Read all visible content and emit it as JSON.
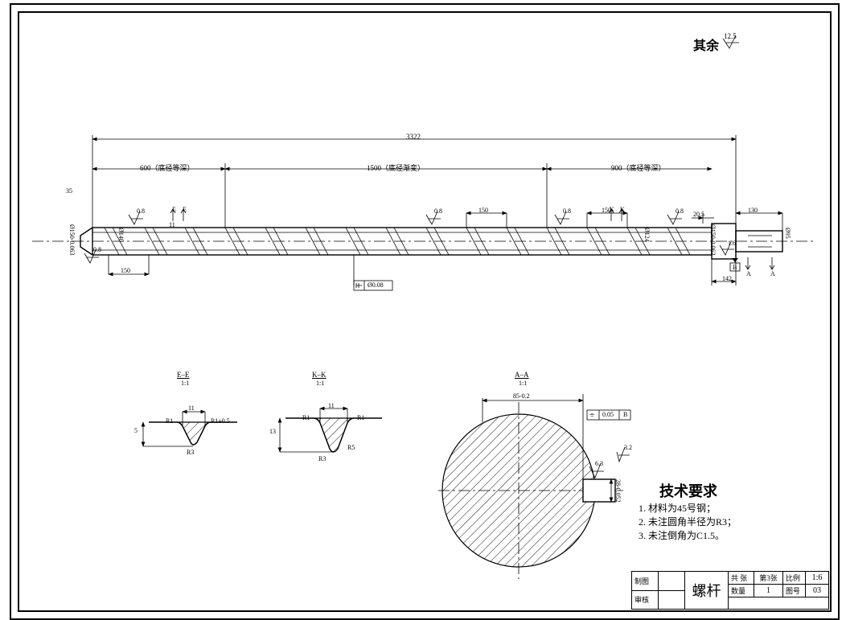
{
  "header": {
    "surface_note": "其余",
    "surface_ra": "12.5"
  },
  "main_view": {
    "overall_length": "3322",
    "section_lengths": {
      "left": "600（底径等深）",
      "mid": "1500（底径渐变）",
      "right": "900（底径等深）"
    },
    "pitches": {
      "p1": "150",
      "p2": "150",
      "p3": "150"
    },
    "thread_width": "11",
    "thread_depth_left": "5",
    "left_small_dim": "35",
    "ra_labels": {
      "a": "0.8",
      "b": "0.8",
      "c": "0.8",
      "d": "0.8",
      "e": "0.8",
      "f": "1.6"
    },
    "diameters": {
      "d_left_outer": "Ø150-0.063",
      "d_core_left": "Ø140",
      "d_core_right": "Ø124",
      "d_right_outer": "Ø150-0.063",
      "d_shaft_end": "Ø95"
    },
    "end_dims": {
      "a": "20.5",
      "b": "130",
      "c": "142"
    },
    "section_marks": {
      "e": "E",
      "k": "K",
      "a": "A"
    },
    "datum_right": "B",
    "geo_tol": "Ø0.08"
  },
  "detail_E": {
    "title": "E–E",
    "scale": "1:1",
    "w": "11",
    "h": "5",
    "r1": "R1",
    "r2": "R1±0.5",
    "r3": "R3"
  },
  "detail_K": {
    "title": "K–K",
    "scale": "1:1",
    "w": "11",
    "h": "13",
    "r_top_l": "R1",
    "r_top_r": "R1",
    "r_bot_l": "R3",
    "r_bot_r": "R5"
  },
  "detail_A": {
    "title": "A–A",
    "scale": "1:1",
    "key_w": "85-0.2",
    "key_h": "28-0.052",
    "ra": "6.3",
    "ra2": "3.2",
    "tol_frame": "0.05",
    "tol_datum": "B",
    "tol_sym": "⌯"
  },
  "notes": {
    "title": "技术要求",
    "items": [
      "1. 材料为45号钢；",
      "2. 未注圆角半径为R3；",
      "3. 未注倒角为C1.5。"
    ]
  },
  "title_block": {
    "part_name": "螺杆",
    "labels": {
      "sheets": "共 张",
      "sheet": "第3张",
      "scale_l": "比例",
      "scale_v": "1:6",
      "qty_l": "数量",
      "qty_v": "1",
      "dwg_l": "图号",
      "dwg_v": "03",
      "drawn": "制图",
      "check": "审核"
    }
  }
}
